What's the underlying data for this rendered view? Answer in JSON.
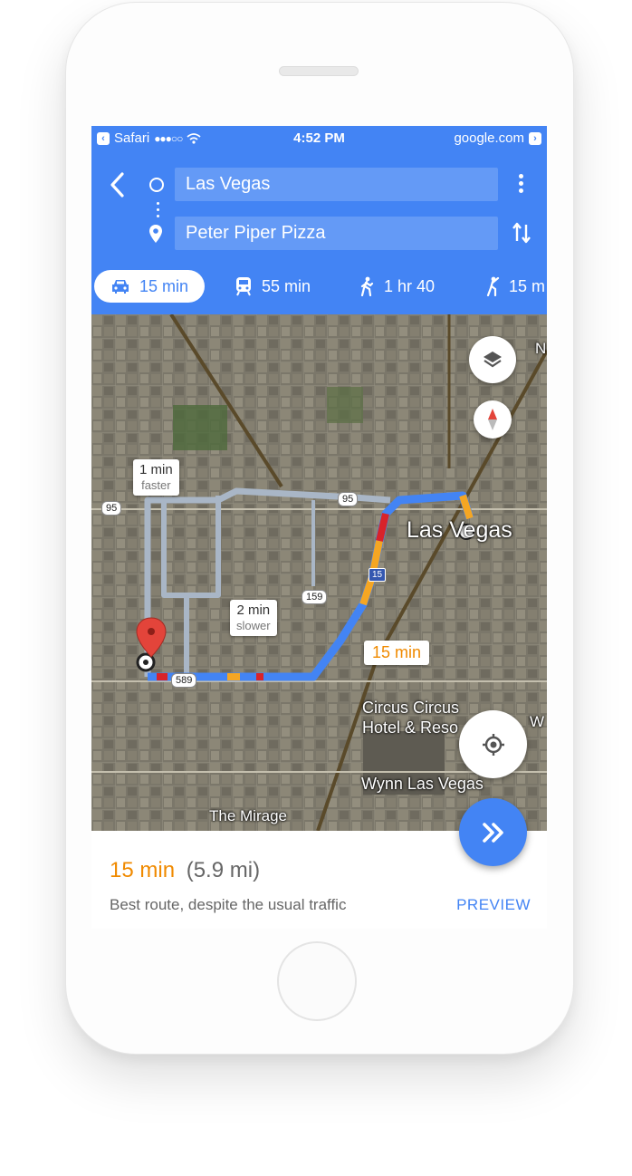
{
  "status_bar": {
    "back_app": "Safari",
    "time": "4:52 PM",
    "url": "google.com"
  },
  "directions": {
    "origin": "Las Vegas",
    "destination": "Peter Piper Pizza"
  },
  "travel_modes": [
    {
      "icon": "car-icon",
      "label": "15 min",
      "selected": true
    },
    {
      "icon": "train-icon",
      "label": "55 min",
      "selected": false
    },
    {
      "icon": "walk-icon",
      "label": "1 hr 40",
      "selected": false
    },
    {
      "icon": "ride-icon",
      "label": "15 m",
      "selected": false
    }
  ],
  "map": {
    "alt_route_1": {
      "time": "1 min",
      "note": "faster"
    },
    "alt_route_2": {
      "time": "2 min",
      "note": "slower"
    },
    "main_route_time": "15 min",
    "places": {
      "city": "Las Vegas",
      "circus_circus_line1": "Circus Circus",
      "circus_circus_line2": "Hotel & Reso",
      "wynn": "Wynn Las Vegas",
      "mirage": "The Mirage",
      "edge_n": "N",
      "edge_w": "W"
    },
    "shields": {
      "us95_left": "95",
      "us95_right": "95",
      "i15": "15",
      "r159": "159",
      "r589": "589"
    }
  },
  "summary": {
    "time": "15 min",
    "distance": "(5.9 mi)",
    "description": "Best route, despite the usual traffic",
    "action": "PREVIEW"
  },
  "colors": {
    "header_blue": "#4384f4",
    "route_blue": "#4384f4",
    "alt_route_gray": "#a9b6c6",
    "traffic_orange": "#f5a623",
    "traffic_red": "#d8232a",
    "eta_orange": "#f08a00"
  }
}
